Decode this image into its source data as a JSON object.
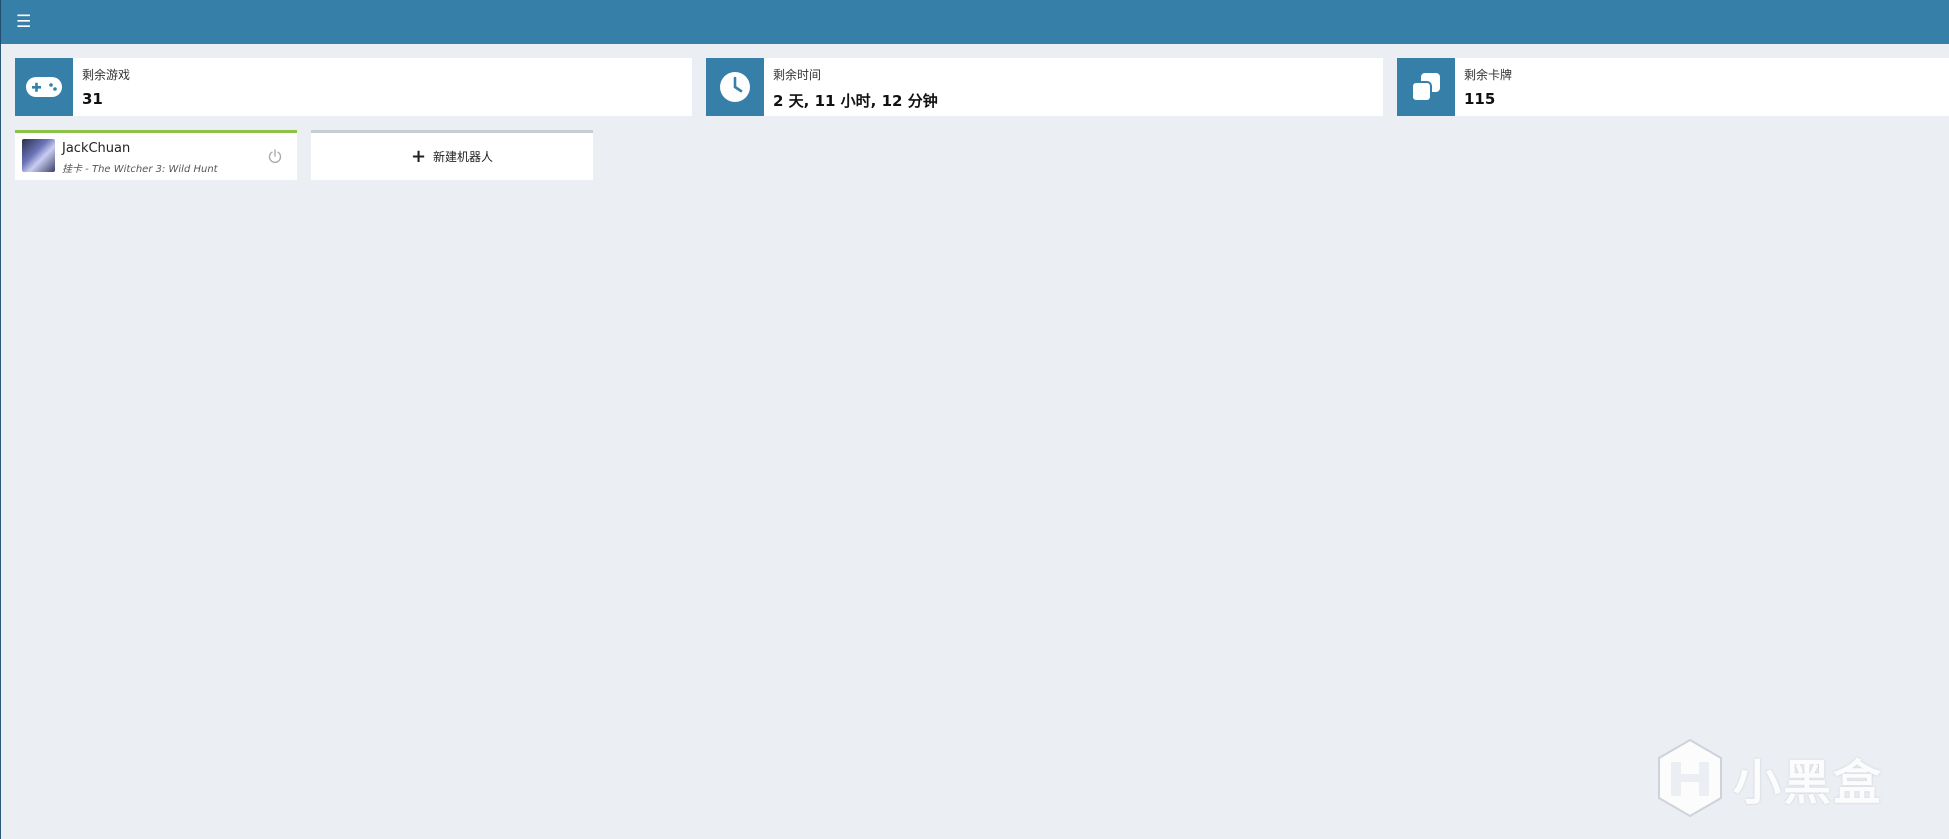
{
  "header": {
    "menu_icon": "hamburger-icon",
    "menu_glyph": "☰"
  },
  "stats": [
    {
      "icon": "gamepad-icon",
      "label": "剩余游戏",
      "value": "31"
    },
    {
      "icon": "clock-icon",
      "label": "剩余时间",
      "value": "2 天, 11 小时, 12 分钟"
    },
    {
      "icon": "cards-icon",
      "label": "剩余卡牌",
      "value": "115"
    }
  ],
  "bot": {
    "name": "JackChuan",
    "status": "挂卡 - The Witcher 3: Wild Hunt",
    "status_color": "#8bc34a"
  },
  "new_bot": {
    "label": "新建机器人",
    "icon_glyph": "+"
  },
  "watermark": {
    "text": "小黑盒"
  },
  "colors": {
    "accent": "#367fa9",
    "background": "#ebeef3"
  }
}
